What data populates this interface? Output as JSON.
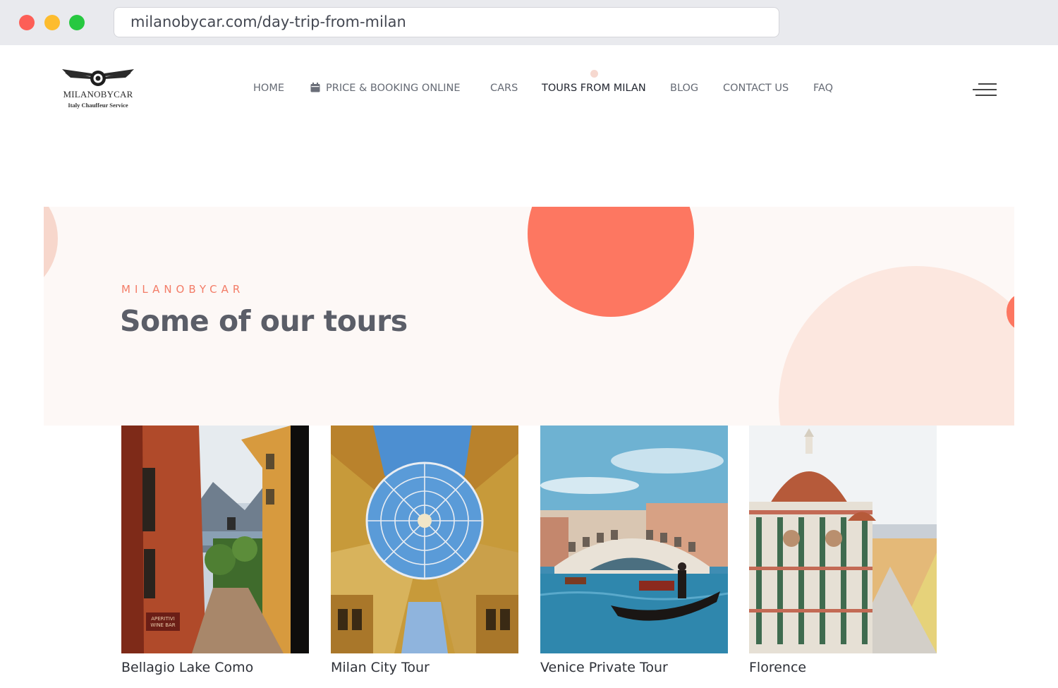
{
  "browser": {
    "url": "milanobycar.com/day-trip-from-milan"
  },
  "logo": {
    "brand": "MILANOBYCAR",
    "tagline": "Italy Chauffeur Service",
    "icon": "winged-wheel-logo"
  },
  "nav": {
    "items": [
      {
        "label": "HOME"
      },
      {
        "label": "PRICE & BOOKING ONLINE",
        "icon": "calendar-icon"
      },
      {
        "label": "CARS"
      },
      {
        "label": "TOURS FROM MILAN",
        "active": true
      },
      {
        "label": "BLOG"
      },
      {
        "label": "CONTACT US"
      },
      {
        "label": "FAQ"
      }
    ],
    "menu_icon": "hamburger-menu-icon"
  },
  "hero": {
    "eyebrow": "MILANOBYCAR",
    "title": "Some of our tours"
  },
  "tours": [
    {
      "title": "Bellagio Lake Como",
      "image": "bellagio-street-photo"
    },
    {
      "title": "Milan City Tour",
      "image": "galleria-dome-photo"
    },
    {
      "title": "Venice Private Tour",
      "image": "venice-rialto-photo"
    },
    {
      "title": "Florence",
      "image": "florence-duomo-photo"
    }
  ],
  "colors": {
    "accent": "#fd7761",
    "hero_bg": "#fdf8f6",
    "eyebrow": "#f37c67"
  }
}
